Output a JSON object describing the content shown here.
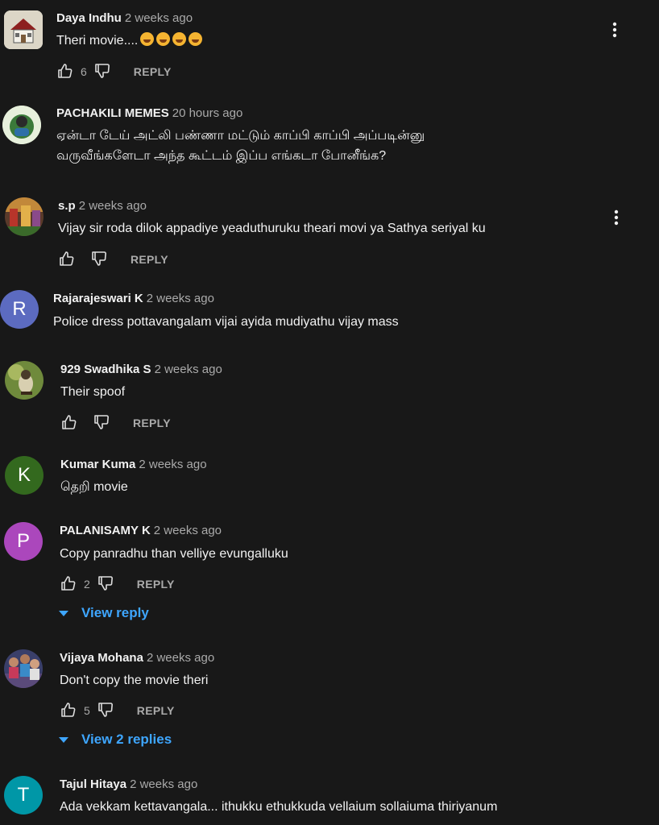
{
  "labels": {
    "reply": "REPLY"
  },
  "comments": [
    {
      "author": "Daya Indhu",
      "time": "2 weeks ago",
      "text": "Theri movie....",
      "emoji_count": 4,
      "likes": "6",
      "avatar": "house-thumbnail"
    },
    {
      "author": "PACHAKILI MEMES",
      "time": "20 hours ago",
      "text_lines": [
        "ஏன்டா டேய் அட்லி பண்ணா மட்டும் காப்பி காப்பி அப்படின்னு",
        "வருவீங்களேடா அந்த கூட்டம் இப்ப எங்கடா போனீங்க?"
      ],
      "avatar": "meme-logo"
    },
    {
      "author": "s.p",
      "time": "2 weeks ago",
      "text": "Vijay sir roda dilok appadiye yeaduthuruku  theari movi ya Sathya seriyal ku",
      "avatar": "photo-thumbnail"
    },
    {
      "author": "Rajarajeswari K",
      "time": "2 weeks ago",
      "text": "Police dress pottavangalam vijai ayida mudiyathu vijay mass",
      "avatar_letter": "R",
      "avatar_color": "#5c6bc0"
    },
    {
      "author": "929 Swadhika S",
      "time": "2 weeks ago",
      "text": "Their spoof",
      "avatar": "bird-photo"
    },
    {
      "author": "Kumar Kuma",
      "time": "2 weeks ago",
      "text": "தெறி movie",
      "avatar_letter": "K",
      "avatar_color": "#33691e"
    },
    {
      "author": "PALANISAMY K",
      "time": "2 weeks ago",
      "text": "Copy panradhu than velliye evungalluku",
      "likes": "2",
      "avatar_letter": "P",
      "avatar_color": "#ab47bc",
      "view_replies": "View reply"
    },
    {
      "author": "Vijaya Mohana",
      "time": "2 weeks ago",
      "text": "Don't copy the movie theri",
      "likes": "5",
      "avatar": "group-photo",
      "view_replies": "View 2 replies"
    },
    {
      "author": "Tajul Hitaya",
      "time": "2 weeks ago",
      "text": "Ada vekkam kettavangala... ithukku ethukkuda vellaium sollaiuma thiriyanum",
      "avatar_letter": "T",
      "avatar_color": "#0097a7"
    }
  ]
}
